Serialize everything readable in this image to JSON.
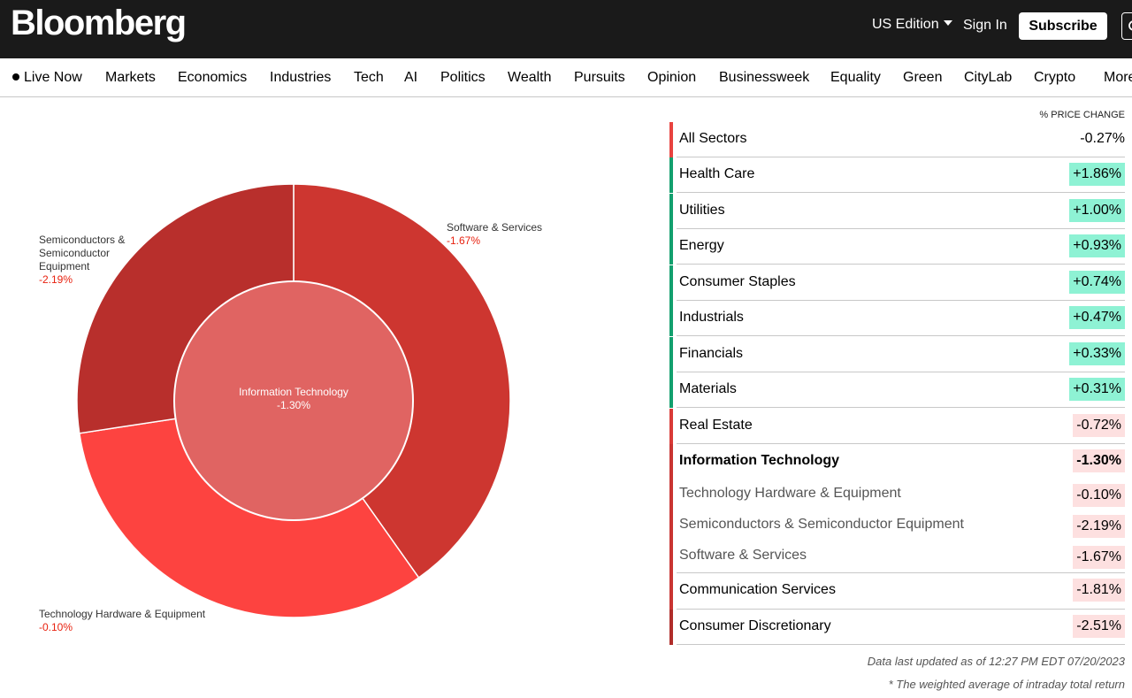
{
  "header": {
    "logo": "Bloomberg",
    "edition": "US Edition",
    "sign_in": "Sign In",
    "subscribe": "Subscribe",
    "search_icon": "search-icon"
  },
  "nav": {
    "items": [
      "Live Now",
      "Markets",
      "Economics",
      "Industries",
      "Tech",
      "AI",
      "Politics",
      "Wealth",
      "Pursuits",
      "Opinion",
      "Businessweek",
      "Equality",
      "Green",
      "CityLab",
      "Crypto",
      "More"
    ]
  },
  "chart_data": {
    "type": "pie",
    "center": {
      "label": "Information Technology",
      "value": "-1.30%"
    },
    "slices": [
      {
        "label": "Software & Services",
        "value": "-1.67%",
        "share": 0.402,
        "color": "#cd3630"
      },
      {
        "label": "Technology Hardware & Equipment",
        "value": "-0.10%",
        "share": 0.324,
        "color": "#fd4340"
      },
      {
        "label": "Semiconductors & Semiconductor Equipment",
        "value": "-2.19%",
        "share": 0.274,
        "color": "#b82f2c"
      }
    ],
    "center_color": "#e06462"
  },
  "table": {
    "header": "% PRICE CHANGE",
    "rows": [
      {
        "name": "All Sectors",
        "value": "-0.27%",
        "type": "plain",
        "bar": "#e8433f"
      },
      {
        "name": "Health Care",
        "value": "+1.86%",
        "type": "pos",
        "bar": "#12a06e"
      },
      {
        "name": "Utilities",
        "value": "+1.00%",
        "type": "pos",
        "bar": "#12a06e"
      },
      {
        "name": "Energy",
        "value": "+0.93%",
        "type": "pos",
        "bar": "#12a06e"
      },
      {
        "name": "Consumer Staples",
        "value": "+0.74%",
        "type": "pos",
        "bar": "#12a06e"
      },
      {
        "name": "Industrials",
        "value": "+0.47%",
        "type": "pos",
        "bar": "#12a06e"
      },
      {
        "name": "Financials",
        "value": "+0.33%",
        "type": "pos",
        "bar": "#12a06e"
      },
      {
        "name": "Materials",
        "value": "+0.31%",
        "type": "pos",
        "bar": "#12a06e"
      },
      {
        "name": "Real Estate",
        "value": "-0.72%",
        "type": "neg",
        "bar": "#d93a37"
      },
      {
        "name": "Information Technology",
        "value": "-1.30%",
        "type": "neg-bold",
        "bar": "#c93532"
      },
      {
        "name": "Technology Hardware & Equipment",
        "value": "-0.10%",
        "type": "neg-sub",
        "bar": "#c93532"
      },
      {
        "name": "Semiconductors & Semiconductor Equipment",
        "value": "-2.19%",
        "type": "neg-sub",
        "bar": "#c93532"
      },
      {
        "name": "Software & Services",
        "value": "-1.67%",
        "type": "neg-sub",
        "bar": "#c93532"
      },
      {
        "name": "Communication Services",
        "value": "-1.81%",
        "type": "neg",
        "bar": "#c93532"
      },
      {
        "name": "Consumer Discretionary",
        "value": "-2.51%",
        "type": "neg",
        "bar": "#b02d2a"
      }
    ]
  },
  "footer": {
    "updated": "Data last updated as of 12:27 PM EDT 07/20/2023",
    "note": "* The weighted average of intraday total return"
  }
}
